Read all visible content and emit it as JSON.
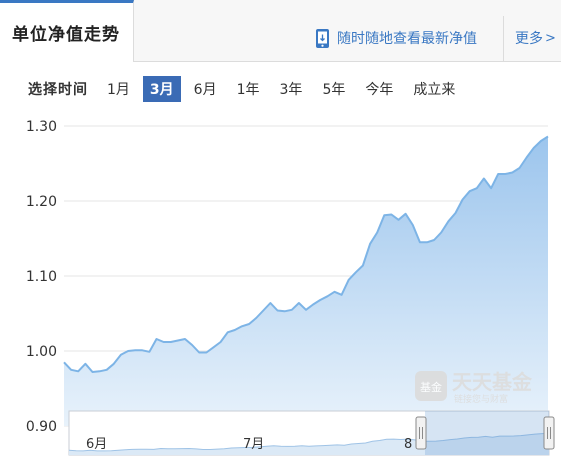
{
  "header": {
    "active_tab": "单位净值走势",
    "promo_text": "随时随地查看最新净值",
    "more_label": "更多",
    "more_chevron": ">"
  },
  "period_selector": {
    "label": "选择时间",
    "options": [
      "1月",
      "3月",
      "6月",
      "1年",
      "3年",
      "5年",
      "今年",
      "成立来"
    ],
    "selected": "3月"
  },
  "watermark": {
    "logo_text": "基金",
    "brand": "天天基金",
    "slogan": "链接您与财富"
  },
  "colors": {
    "accent": "#3a78c3",
    "line": "#7db4e6",
    "area_top": "#9cc5ed",
    "area_bottom": "#e8f2fb"
  },
  "chart_data": {
    "type": "area",
    "y_ticks": [
      "1.30",
      "1.20",
      "1.10",
      "1.00",
      "0.90"
    ],
    "ylim": [
      0.9,
      1.3
    ],
    "xlabel": "",
    "ylabel": "",
    "grid": true,
    "navigator_labels": [
      "6月",
      "7月",
      "8"
    ],
    "series": [
      {
        "values": [
          0.985,
          0.975,
          0.973,
          0.983,
          0.972,
          0.973,
          0.975,
          0.983,
          0.995,
          1.0,
          1.001,
          1.001,
          0.999,
          1.016,
          1.012,
          1.012,
          1.014,
          1.016,
          1.008,
          0.998,
          0.998,
          1.005,
          1.012,
          1.025,
          1.028,
          1.033,
          1.036,
          1.044,
          1.054,
          1.064,
          1.054,
          1.053,
          1.055,
          1.064,
          1.055,
          1.062,
          1.068,
          1.073,
          1.079,
          1.075,
          1.095,
          1.105,
          1.114,
          1.143,
          1.158,
          1.181,
          1.182,
          1.175,
          1.183,
          1.168,
          1.145,
          1.145,
          1.148,
          1.158,
          1.173,
          1.184,
          1.202,
          1.213,
          1.217,
          1.23,
          1.217,
          1.236,
          1.236,
          1.238,
          1.244,
          1.258,
          1.271,
          1.28,
          1.286
        ]
      }
    ]
  }
}
